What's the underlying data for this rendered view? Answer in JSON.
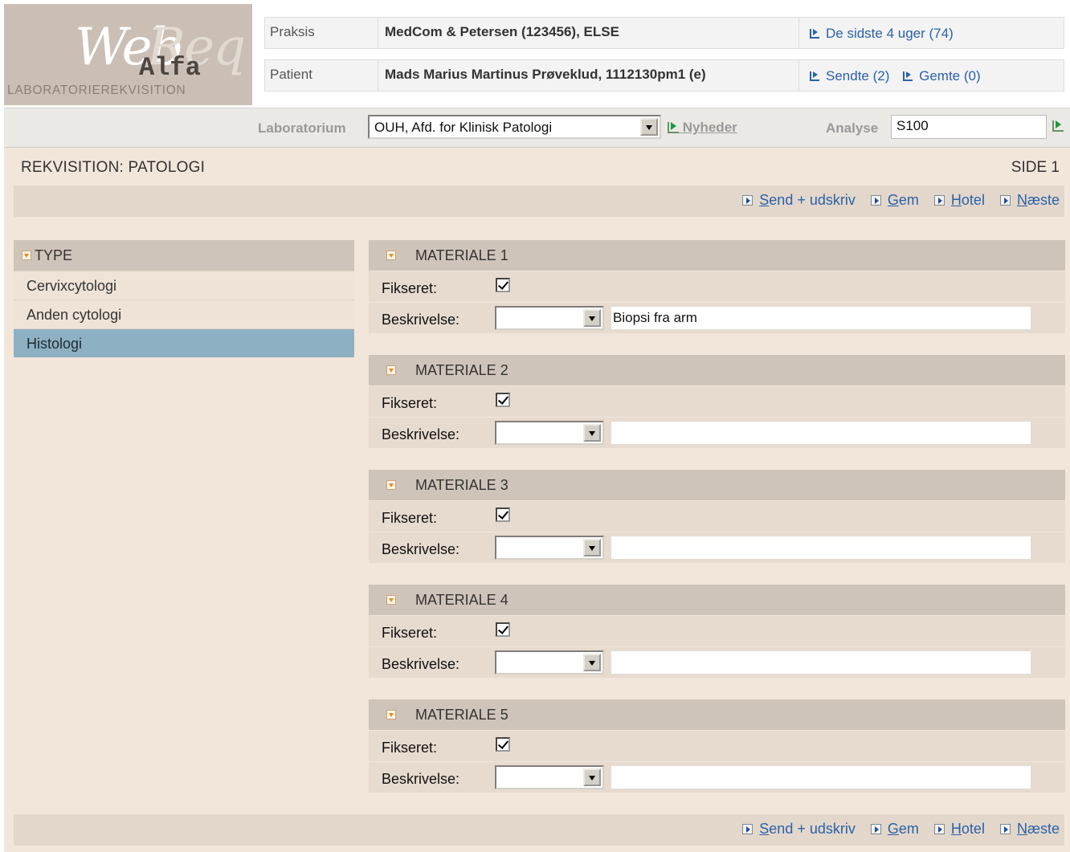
{
  "logo": {
    "web": "Web",
    "req": "Req",
    "alfa": "Alfa",
    "subtitle": "LABORATORIEREKVISITION"
  },
  "header": {
    "praksis": {
      "label": "Praksis",
      "value": "MedCom & Petersen (123456), ELSE",
      "link": "De sidste 4 uger (74)"
    },
    "patient": {
      "label": "Patient",
      "value": "Mads Marius Martinus Prøveklud, 1112130pm1 (e)",
      "link_sent": "Sendte (2)",
      "link_saved": "Gemte (0)"
    }
  },
  "labbar": {
    "lab_label": "Laboratorium",
    "lab_selected": "OUH, Afd. for Klinisk Patologi",
    "news_label": "Nyheder",
    "analysis_label": "Analyse",
    "analysis_value": "S100"
  },
  "requisition": {
    "title": "REKVISITION: PATOLOGI",
    "page": "SIDE 1"
  },
  "actions": {
    "send_first": "S",
    "send_rest": "end + udskriv",
    "save_first": "G",
    "save_rest": "em",
    "hotel_first": "H",
    "hotel_rest": "otel",
    "next_first": "N",
    "next_rest": "æste"
  },
  "type_panel": {
    "heading": "TYPE",
    "items": [
      {
        "label": "Cervixcytologi",
        "active": false
      },
      {
        "label": "Anden cytologi",
        "active": false
      },
      {
        "label": "Histologi",
        "active": true
      }
    ]
  },
  "materials": [
    {
      "title": "MATERIALE 1",
      "fixed_label": "Fikseret:",
      "fixed": true,
      "desc_label": "Beskrivelse:",
      "desc_select": "",
      "desc_text": "Biopsi fra arm"
    },
    {
      "title": "MATERIALE 2",
      "fixed_label": "Fikseret:",
      "fixed": true,
      "desc_label": "Beskrivelse:",
      "desc_select": "",
      "desc_text": ""
    },
    {
      "title": "MATERIALE 3",
      "fixed_label": "Fikseret:",
      "fixed": true,
      "desc_label": "Beskrivelse:",
      "desc_select": "",
      "desc_text": ""
    },
    {
      "title": "MATERIALE 4",
      "fixed_label": "Fikseret:",
      "fixed": true,
      "desc_label": "Beskrivelse:",
      "desc_select": "",
      "desc_text": ""
    },
    {
      "title": "MATERIALE 5",
      "fixed_label": "Fikseret:",
      "fixed": true,
      "desc_label": "Beskrivelse:",
      "desc_select": "",
      "desc_text": ""
    }
  ],
  "colors": {
    "link": "#2a62a8",
    "active_item": "#8eb0c3",
    "panel_bg": "#f2e6da",
    "section_head": "#cfc4b9"
  }
}
